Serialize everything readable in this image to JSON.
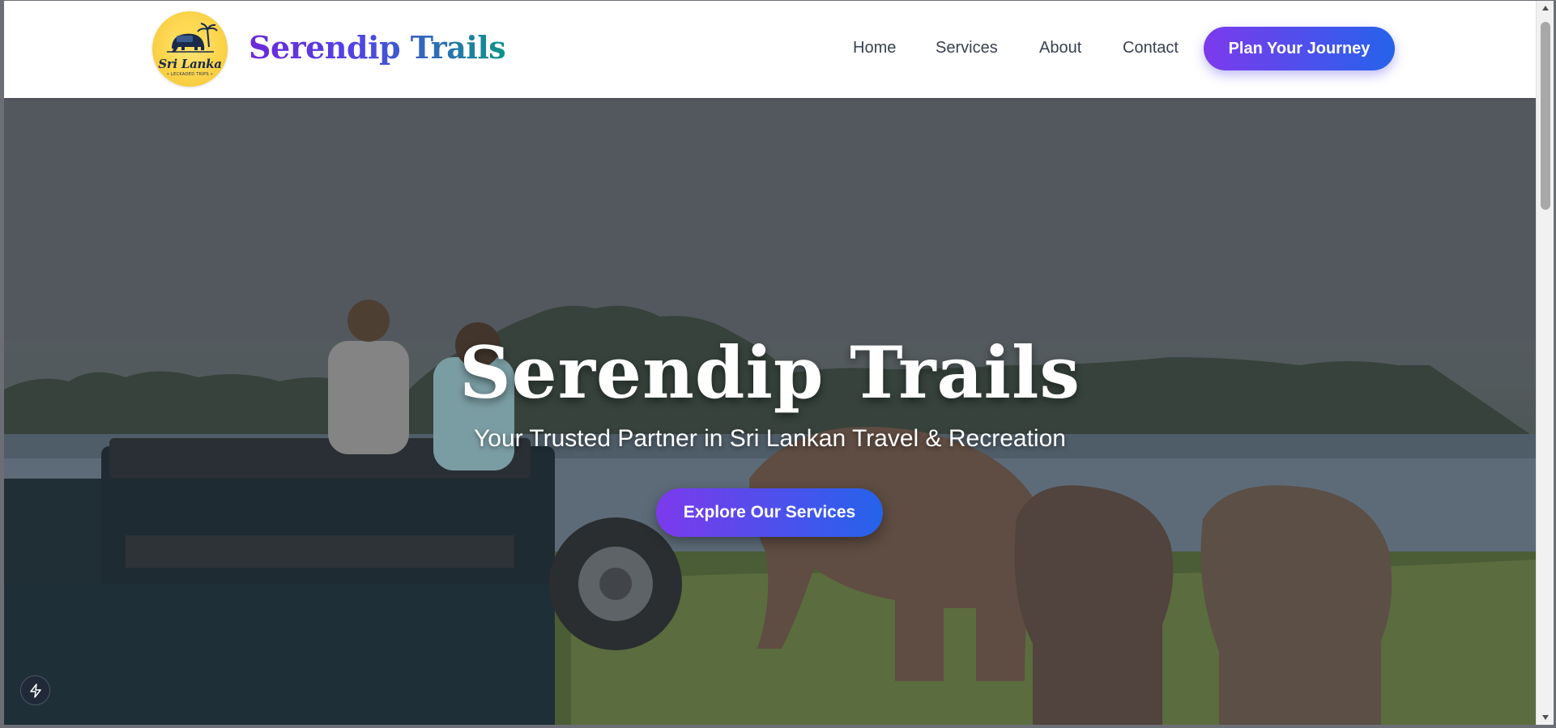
{
  "header": {
    "logo": {
      "text": "Sri Lanka",
      "subtext": "• LECKADED TRIPS •",
      "icon": "elephant-icon"
    },
    "brand_name": "Serendip Trails",
    "nav": {
      "home": "Home",
      "services": "Services",
      "about": "About",
      "contact": "Contact"
    },
    "cta_label": "Plan Your Journey"
  },
  "hero": {
    "title": "Serendip Trails",
    "subtitle": "Your Trusted Partner in Sri Lankan Travel & Recreation",
    "cta_label": "Explore Our Services",
    "background": "safari-jeep-elephants-photo"
  },
  "floating_button": {
    "icon": "lightning-bolt-icon"
  },
  "colors": {
    "gradient_start": "#7c3aed",
    "gradient_end": "#2563eb",
    "brand_teal": "#0d9488",
    "nav_text": "#374151",
    "logo_yellow": "#fbd44a"
  }
}
